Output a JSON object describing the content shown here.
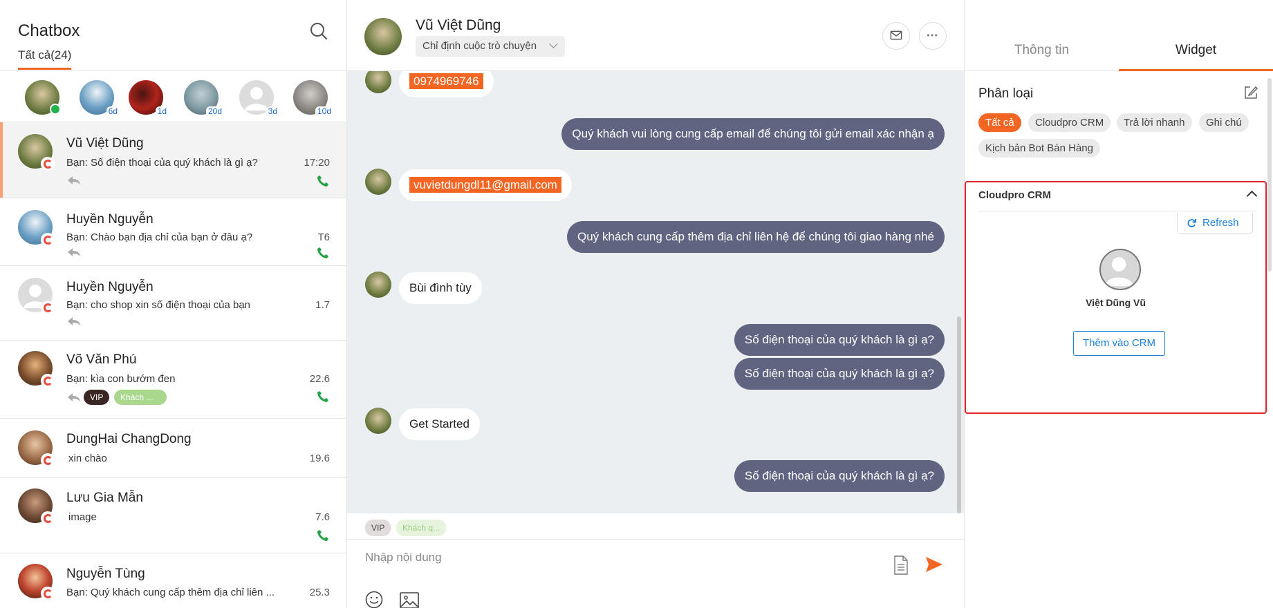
{
  "sidebar": {
    "title": "Chatbox",
    "filter_all": "Tất cả(24)",
    "recent": [
      {
        "badge": "",
        "online": true,
        "color": "#6b7a3f"
      },
      {
        "badge": "6d",
        "online": false,
        "color": "#6a9fc4"
      },
      {
        "badge": "1d",
        "online": false,
        "color": "#b0241c"
      },
      {
        "badge": "20d",
        "online": false,
        "color": "#7f9aa3"
      },
      {
        "badge": "3d",
        "online": false,
        "color": "#d4d4d4"
      },
      {
        "badge": "10d",
        "online": false,
        "color": "#8d8a86"
      }
    ],
    "conversations": [
      {
        "name": "Vũ Việt Dũng",
        "preview": "Bạn: Số điện thoại của quý khách là gì ạ?",
        "time": "17:20"
      },
      {
        "name": "Huyền Nguyễn",
        "preview": "Bạn: Chào bạn địa chỉ của bạn ở đâu ạ?",
        "time": "T6"
      },
      {
        "name": "Huyền Nguyễn",
        "preview": "Bạn: cho shop xin số điện thoại của bạn",
        "time": "1.7"
      },
      {
        "name": "Võ Văn Phú",
        "preview": "Bạn: kìa con bướm đen",
        "time": "22.6",
        "tag_vip": "VIP",
        "tag_kh": "Khách ..."
      },
      {
        "name": "DungHai ChangDong",
        "preview": "xin chào",
        "time": "19.6"
      },
      {
        "name": "Lưu Gia Mẫn",
        "preview": "image",
        "time": "7.6"
      },
      {
        "name": "Nguyễn Tùng",
        "preview": "Bạn: Quý khách cung cấp thêm địa chỉ liên ...",
        "time": "25.3"
      }
    ]
  },
  "chat": {
    "contact_name": "Vũ Việt Dũng",
    "assign_label": "Chỉ định cuộc trò chuyện",
    "messages": [
      {
        "dir": "in",
        "text": "0974969746",
        "highlight": true
      },
      {
        "dir": "out",
        "text": "Quý khách vui lòng cung cấp email để chúng tôi gửi email xác nhận ạ"
      },
      {
        "dir": "in",
        "text": "vuvietdungdl11@gmail.com",
        "highlight": true
      },
      {
        "dir": "out",
        "text": "Quý khách cung cấp thêm địa chỉ liên hệ để chúng tôi giao hàng nhé"
      },
      {
        "dir": "in",
        "text": "Bùi đình tùy"
      },
      {
        "dir": "out",
        "text": "Số điện thoại của quý khách là gì ạ?"
      },
      {
        "dir": "out",
        "text": "Số điện thoại của quý khách là gì ạ?"
      },
      {
        "dir": "in",
        "text": "Get Started"
      },
      {
        "dir": "out",
        "text": "Số điện thoại của quý khách là gì ạ?"
      }
    ],
    "tags": {
      "vip": "VIP",
      "kh": "Khách q..."
    },
    "input_placeholder": "Nhập nội dung"
  },
  "panel": {
    "tabs": [
      "Thông tin",
      "Widget"
    ],
    "category_title": "Phân loại",
    "chips": [
      "Tất cả",
      "Cloudpro CRM",
      "Trả lời nhanh",
      "Ghi chú",
      "Kịch bản Bot Bán Hàng"
    ],
    "widget": {
      "title": "Cloudpro CRM",
      "refresh_label": "Refresh",
      "contact_name": "Việt Dũng Vũ",
      "add_label": "Thêm vào CRM"
    }
  },
  "colors": {
    "accent": "#f26522",
    "bubble_out": "#5f6480",
    "link": "#1a7fd6",
    "highlight_border": "#e3242b"
  }
}
